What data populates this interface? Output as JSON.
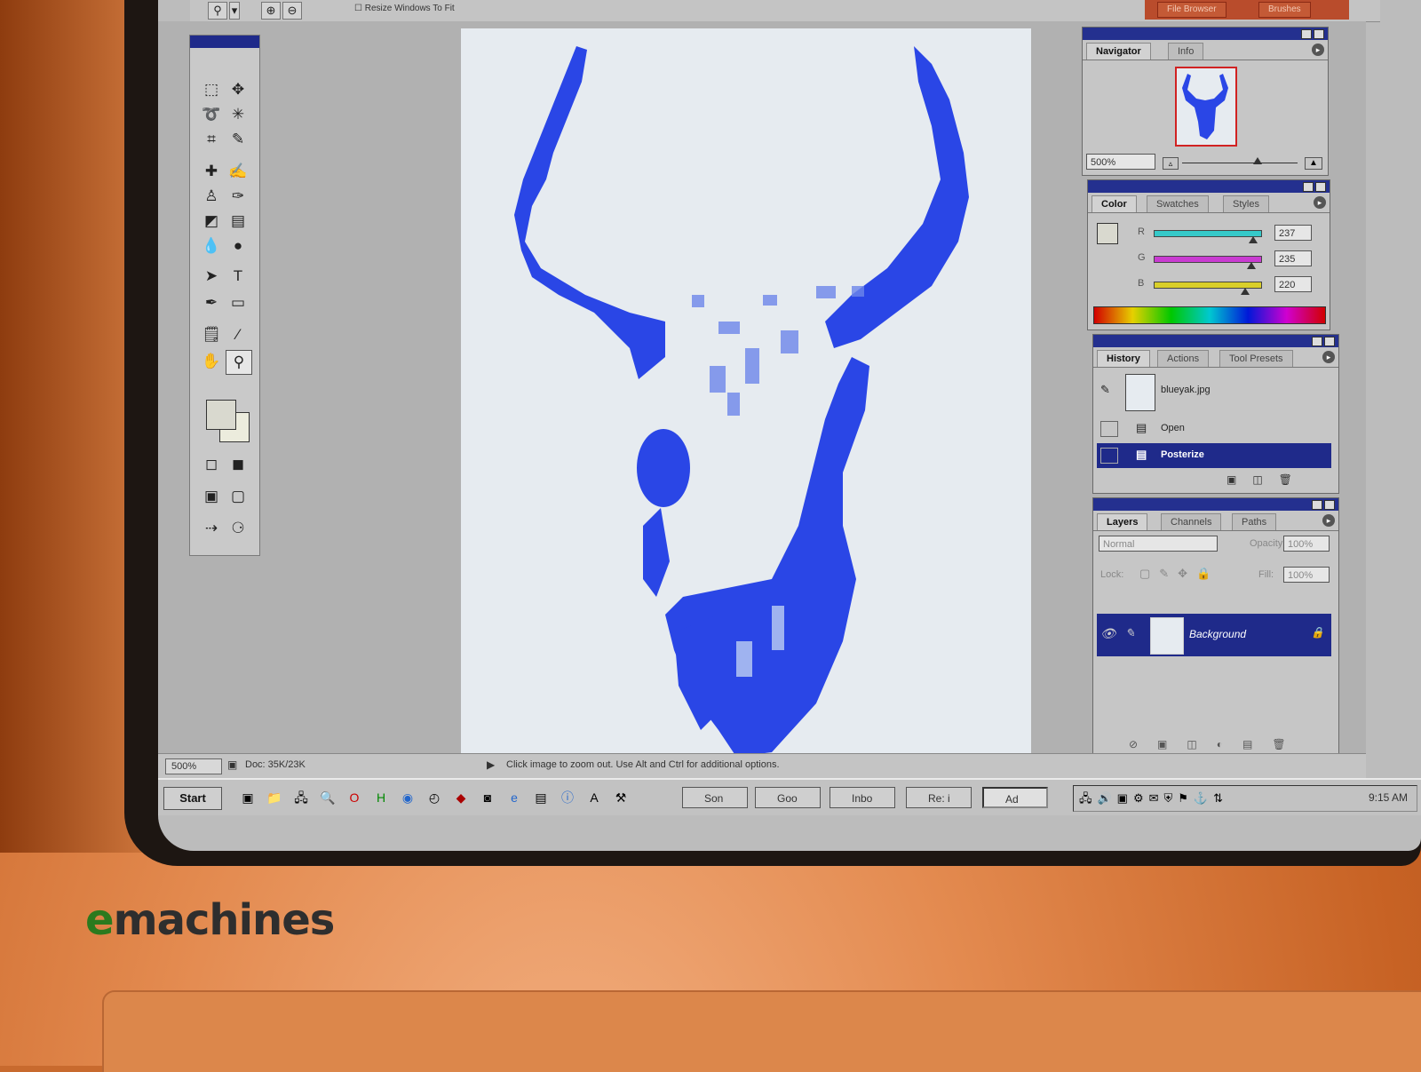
{
  "toolbar": {
    "resize_windows_label": "Resize Windows To Fit",
    "palette_tabs": [
      "File Browser",
      "Brushes"
    ]
  },
  "document": {
    "zoom": "500%",
    "doc_size": "Doc: 35K/23K",
    "status_tip": "Click image to zoom out. Use Alt and Ctrl for additional options."
  },
  "navigator": {
    "tabs": [
      "Navigator",
      "Info"
    ],
    "zoom": "500%"
  },
  "color": {
    "tabs": [
      "Color",
      "Swatches",
      "Styles"
    ],
    "channels": [
      {
        "label": "R",
        "value": "237",
        "color": "#35c9c9",
        "level": 0.93
      },
      {
        "label": "G",
        "value": "235",
        "color": "#c93bd1",
        "level": 0.92
      },
      {
        "label": "B",
        "value": "220",
        "color": "#d9cf2a",
        "level": 0.86
      }
    ]
  },
  "history": {
    "tabs": [
      "History",
      "Actions",
      "Tool Presets"
    ],
    "snapshot": "blueyak.jpg",
    "steps": [
      "Open",
      "Posterize"
    ]
  },
  "layers": {
    "tabs": [
      "Layers",
      "Channels",
      "Paths"
    ],
    "blend_mode": "Normal",
    "opacity_label": "Opacity:",
    "opacity": "100%",
    "lock_label": "Lock:",
    "fill_label": "Fill:",
    "fill": "100%",
    "layer_name": "Background"
  },
  "taskbar": {
    "start": "Start",
    "tasks": [
      "Son",
      "Goo",
      "Inbo",
      "Re: i",
      "Ad"
    ],
    "clock": "9:15 AM"
  },
  "bezel": {
    "brand_e": "e",
    "brand_rest": "machines"
  },
  "colors": {
    "accent": "#1f2a8a",
    "artwork": "#2a46e6",
    "bezel": "#d77b3e"
  }
}
